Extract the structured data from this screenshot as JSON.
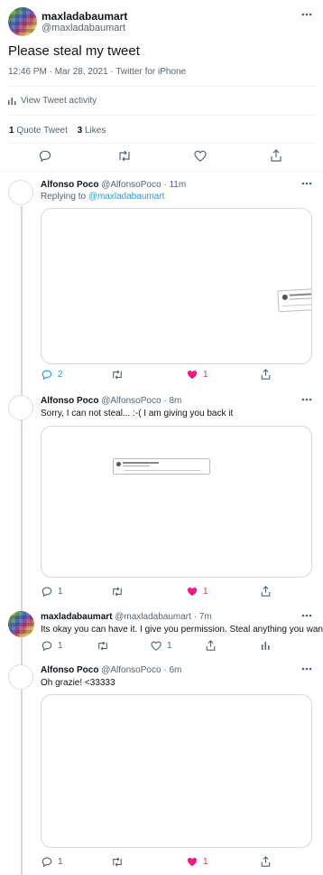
{
  "main_tweet": {
    "display_name": "maxladabaumart",
    "handle": "@maxladabaumart",
    "text": "Please steal my tweet",
    "timestamp": "12:46 PM · Mar 28, 2021",
    "source": "Twitter for iPhone",
    "activity_label": "View Tweet activity",
    "quote_count": "1",
    "quote_label": "Quote Tweet",
    "like_count": "3",
    "like_label": "Likes"
  },
  "replies": [
    {
      "display_name": "Alfonso Poco",
      "handle": "@AlfonsoPoco",
      "time": "11m",
      "replying_prefix": "Replying to",
      "replying_to": "@maxladabaumart",
      "reply_count": "2",
      "like_count": "1",
      "liked": true
    },
    {
      "display_name": "Alfonso Poco",
      "handle": "@AlfonsoPoco",
      "time": "8m",
      "text": "Sorry, I can not steal... :-( I am giving you back it",
      "reply_count": "1",
      "like_count": "1",
      "liked": true
    },
    {
      "display_name": "maxladabaumart",
      "handle": "@maxladabaumart",
      "time": "7m",
      "text": "Its okay you can have it. I give you permission. Steal anything you want.",
      "reply_count": "1",
      "like_count": "1",
      "liked": false
    },
    {
      "display_name": "Alfonso Poco",
      "handle": "@AlfonsoPoco",
      "time": "6m",
      "text": "Oh grazie! <33333",
      "reply_count": "1",
      "like_count": "1",
      "liked": true
    }
  ],
  "colors": {
    "accent": "#1d9bf0",
    "like": "#f91880",
    "muted": "#536471"
  }
}
